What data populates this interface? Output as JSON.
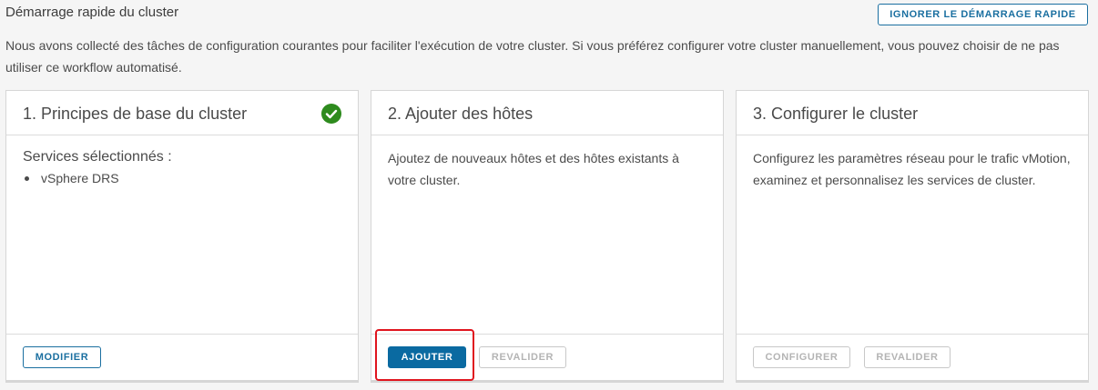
{
  "header": {
    "title": "Démarrage rapide du cluster",
    "skip_label": "IGNORER LE DÉMARRAGE RAPIDE"
  },
  "intro_text": "Nous avons collecté des tâches de configuration courantes pour faciliter l'exécution de votre cluster. Si vous préférez configurer votre cluster manuellement, vous pouvez choisir de ne pas utiliser ce workflow automatisé.",
  "cards": [
    {
      "title": "1. Principes de base du cluster",
      "status_icon": "check-circle-icon",
      "status_color": "#2e8b1e",
      "services_label": "Services sélectionnés :",
      "services": [
        "vSphere DRS"
      ],
      "buttons": [
        {
          "label": "MODIFIER",
          "state": "enabled"
        }
      ]
    },
    {
      "title": "2. Ajouter des hôtes",
      "description": "Ajoutez de nouveaux hôtes et des hôtes existants à votre cluster.",
      "buttons": [
        {
          "label": "AJOUTER",
          "state": "primary"
        },
        {
          "label": "REVALIDER",
          "state": "disabled"
        }
      ]
    },
    {
      "title": "3. Configurer le cluster",
      "description": "Configurez les paramètres réseau pour le trafic vMotion, examinez et personnalisez les services de cluster.",
      "buttons": [
        {
          "label": "CONFIGURER",
          "state": "disabled"
        },
        {
          "label": "REVALIDER",
          "state": "disabled"
        }
      ]
    }
  ],
  "colors": {
    "accent": "#0a6aa1",
    "highlight": "#e0141e"
  }
}
